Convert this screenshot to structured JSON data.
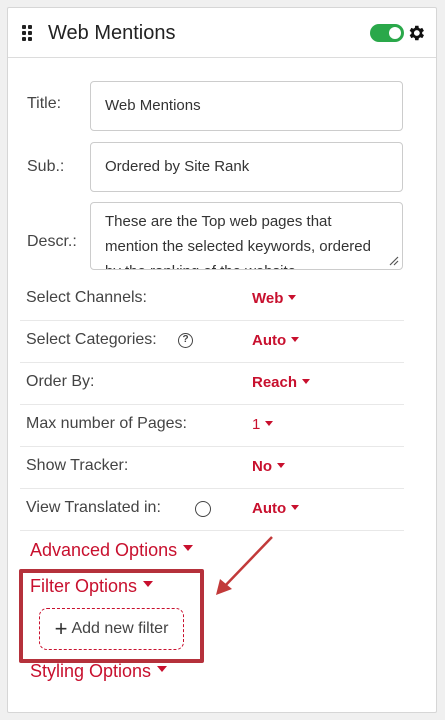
{
  "header": {
    "title": "Web Mentions",
    "toggle_state": "on",
    "toggle_color": "#2aa84a"
  },
  "fields": {
    "title": {
      "label": "Title:",
      "value": "Web Mentions"
    },
    "sub": {
      "label": "Sub.:",
      "value": "Ordered by Site Rank"
    },
    "descr": {
      "label": "Descr.:",
      "value": "These are the Top web pages that mention the selected keywords, ordered by the ranking of the website"
    }
  },
  "options": [
    {
      "label": "Select Channels:",
      "value": "Web"
    },
    {
      "label": "Select Categories:",
      "value": "Auto"
    },
    {
      "label": "Order By:",
      "value": "Reach"
    },
    {
      "label": "Max number of Pages:",
      "value": "1"
    },
    {
      "label": "Show Tracker:",
      "value": "No"
    },
    {
      "label": "View Translated in:",
      "value": "Auto"
    }
  ],
  "sections": {
    "advanced": "Advanced Options",
    "filter": "Filter Options",
    "add_filter": "Add new filter",
    "styling": "Styling Options"
  },
  "colors": {
    "accent": "#c8102e",
    "highlight": "#b5313b"
  }
}
